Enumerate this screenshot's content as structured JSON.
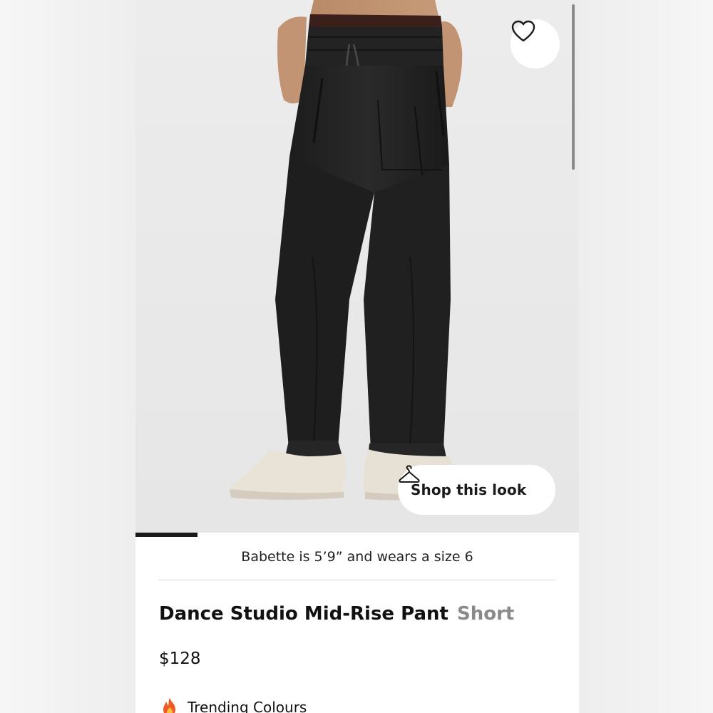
{
  "product": {
    "name": "Dance Studio Mid-Rise Pant",
    "variant": "Short",
    "price": "$128",
    "model_caption": "Babette is 5’9” and wears a size 6"
  },
  "actions": {
    "shop_this_look": "Shop this look"
  },
  "trending": {
    "label": "Trending Colours"
  },
  "gallery": {
    "progress_fraction": 0.14
  },
  "icons": {
    "favorite": "heart-outline-icon",
    "shop_look": "hanger-icon",
    "trending": "flame-icon"
  },
  "colors": {
    "text": "#111111",
    "variant_text": "#8a8a8a",
    "progress": "#1a1a1a",
    "flame": "#f05a24"
  }
}
